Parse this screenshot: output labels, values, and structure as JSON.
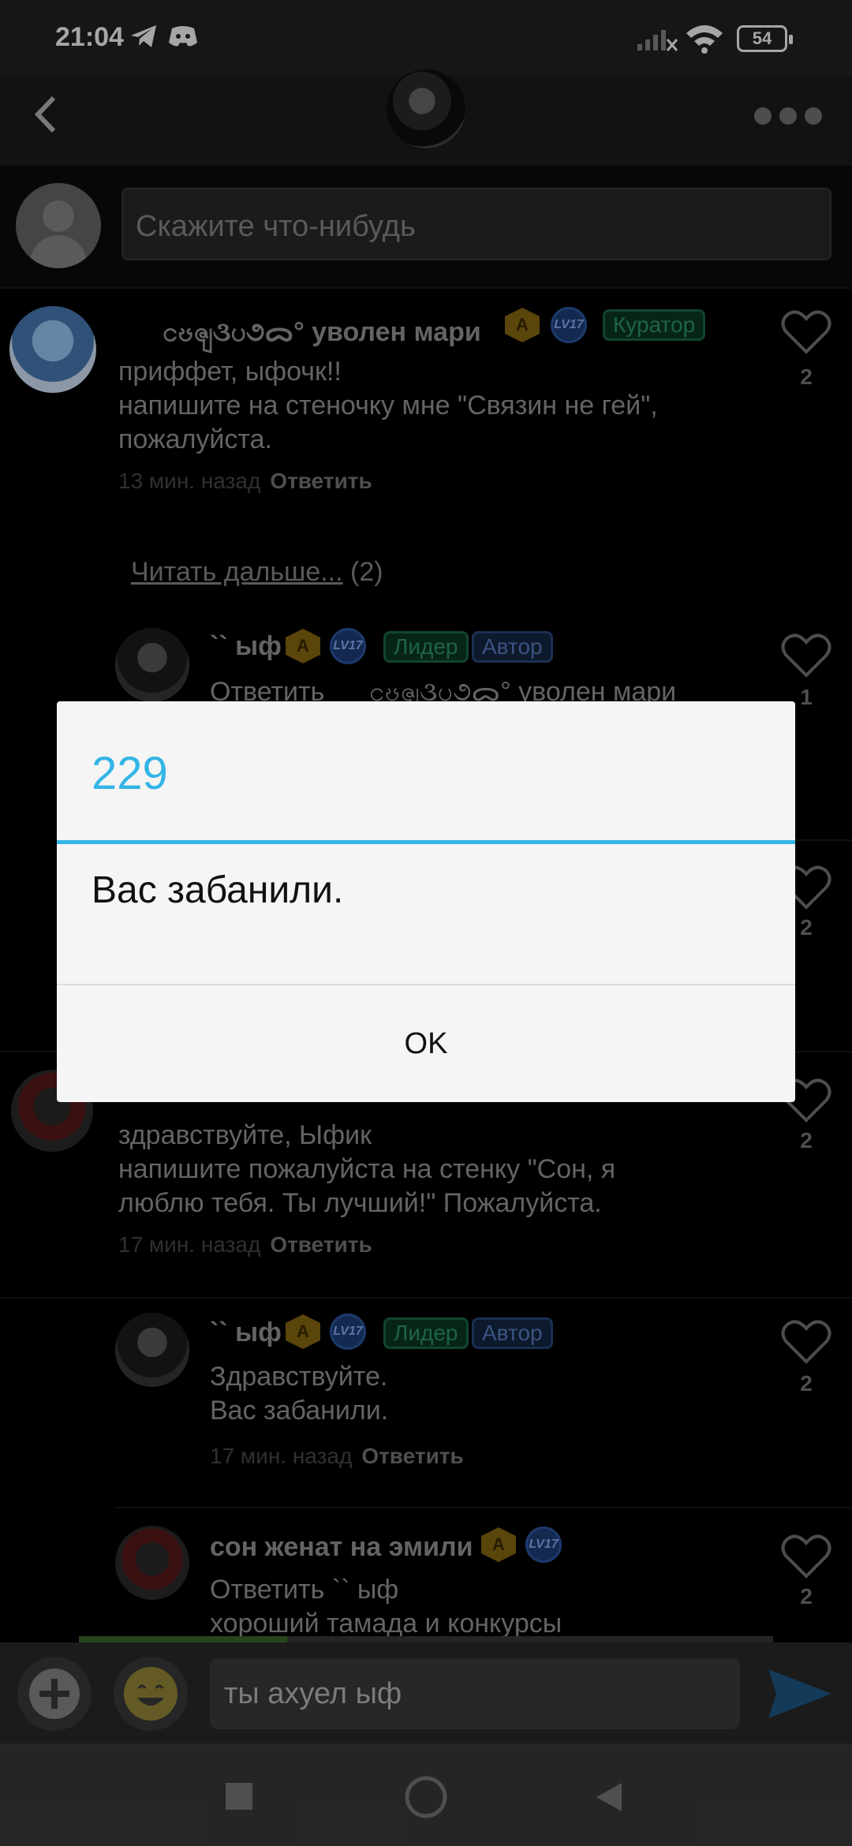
{
  "status_bar": {
    "time": "21:04",
    "battery": "54"
  },
  "top_bar": {
    "back_icon": "chevron-left-icon",
    "menu_icon": "more-dots-icon"
  },
  "composer": {
    "placeholder": "Скажите что-нибудь"
  },
  "comments": [
    {
      "name": "ငၓၛ૩ပ૭ᯅ° уволен мари",
      "level": "LV17",
      "level_badge_text": "A",
      "roles": [
        "Куратор"
      ],
      "text": "приффет, ыфочк!!\nнапишите на стеночку мне \"Связин не гей\",\nпожалуйста.",
      "time": "13 мин. назад",
      "reply": "Ответить",
      "likes": "2"
    },
    {
      "name": "`` ыф",
      "level": "LV17",
      "level_badge_text": "A",
      "roles": [
        "Лидер",
        "Автор"
      ],
      "text": "Ответить      ငၓၛ૩ပ૭ᯅ° уволен мари",
      "likes": "1"
    },
    {
      "hidden_likes": "2"
    },
    {
      "text": "здравствуйте, Ыфик\nнапишите пожалуйста на стенку \"Сон, я\nлюблю тебя. Ты лучший!\" Пожалуйста.",
      "time": "17 мин. назад",
      "reply": "Ответить",
      "likes": "2"
    },
    {
      "name": "`` ыф",
      "level": "LV17",
      "level_badge_text": "A",
      "roles": [
        "Лидер",
        "Автор"
      ],
      "text": "Здравствуйте.\nВас забанили.",
      "time": "17 мин. назад",
      "reply": "Ответить",
      "likes": "2"
    },
    {
      "name": "сон женат на эмили",
      "level": "LV17",
      "level_badge_text": "A",
      "text": "Ответить `` ыф\nхороший тамада и конкурсы",
      "likes": "2"
    }
  ],
  "read_more": {
    "label": "Читать дальше...",
    "count": "(2)"
  },
  "dialog": {
    "title": "229",
    "message": "Вас забанили.",
    "ok": "OK"
  },
  "input_bar": {
    "message": "ты ахуел ыф",
    "progress": 0.3
  },
  "colors": {
    "accent": "#33b5e5",
    "dim_overlay": "rgba(0,0,0,0.6)"
  }
}
